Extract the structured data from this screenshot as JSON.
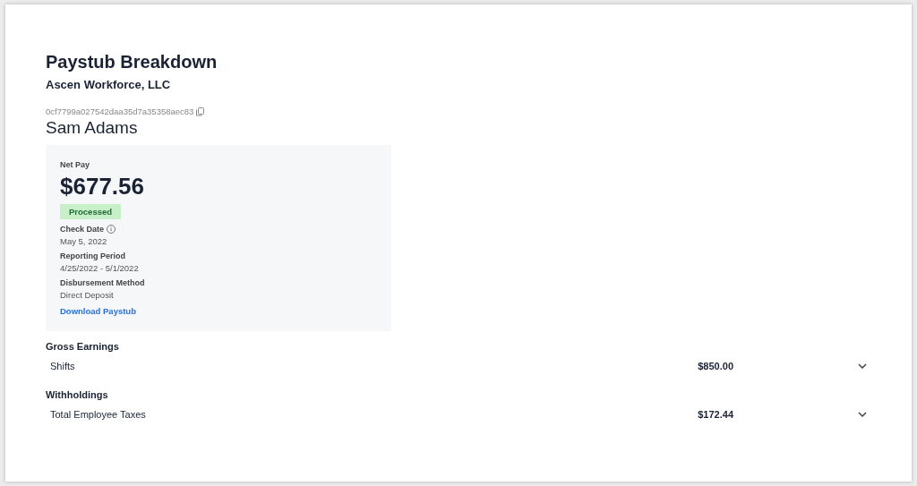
{
  "title": "Paystub Breakdown",
  "employer": "Ascen Workforce, LLC",
  "employee": {
    "id": "0cf7799a027542daa35d7a35358aec83",
    "name": "Sam Adams"
  },
  "summary": {
    "net_pay_label": "Net Pay",
    "net_pay": "$677.56",
    "status": {
      "label": "Processed",
      "kind": "success"
    },
    "details": [
      {
        "label": "Check Date",
        "value": "May 5, 2022",
        "info": true
      },
      {
        "label": "Reporting Period",
        "value": "4/25/2022 - 5/1/2022",
        "info": false
      },
      {
        "label": "Disbursement Method",
        "value": "Direct Deposit",
        "info": false
      }
    ],
    "link": "Download Paystub"
  },
  "sections": [
    {
      "title": "Gross Earnings",
      "rows": [
        {
          "label": "Shifts",
          "amount": "$850.00",
          "expanded": false
        }
      ]
    },
    {
      "title": "Withholdings",
      "rows": [
        {
          "label": "Total Employee Taxes",
          "amount": "$172.44",
          "expanded": false
        }
      ]
    }
  ]
}
